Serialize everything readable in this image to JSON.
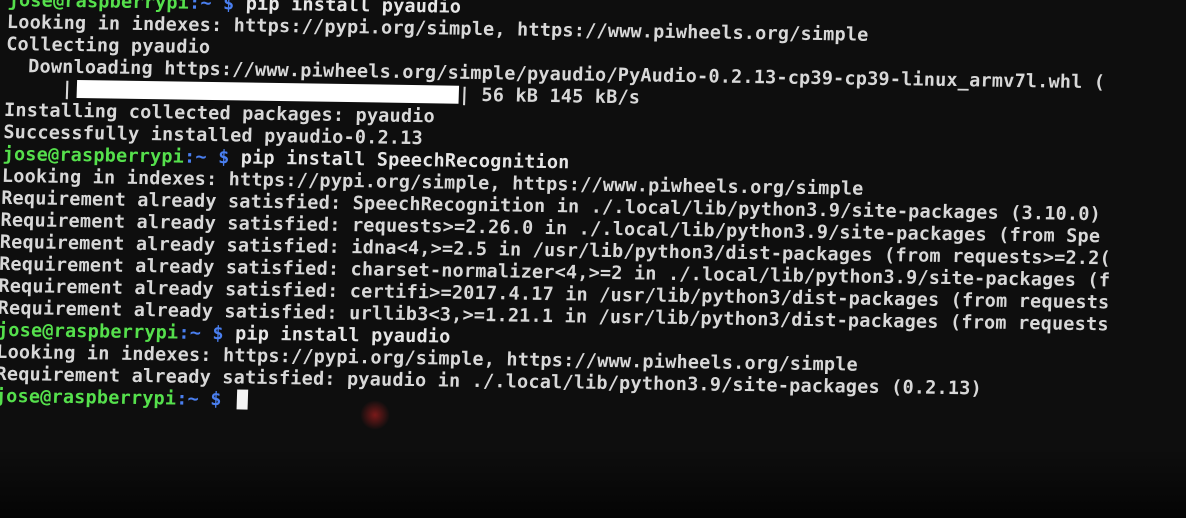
{
  "terminal": {
    "prompt": {
      "user_host": "jose@raspberrypi",
      "path": ":~",
      "symbol": "$"
    },
    "lines": [
      {
        "kind": "prompt",
        "command": "pip install pyaudio"
      },
      {
        "kind": "text",
        "text": "Looking in indexes: https://pypi.org/simple, https://www.piwheels.org/simple"
      },
      {
        "kind": "text",
        "text": "Collecting pyaudio"
      },
      {
        "kind": "text",
        "text": "  Downloading https://www.piwheels.org/simple/pyaudio/PyAudio-0.2.13-cp39-cp39-linux_armv7l.whl ("
      },
      {
        "kind": "progress",
        "prefix": "     |",
        "suffix": "| 56 kB 145 kB/s",
        "fill": 1.0
      },
      {
        "kind": "text",
        "text": "Installing collected packages: pyaudio"
      },
      {
        "kind": "text",
        "text": "Successfully installed pyaudio-0.2.13"
      },
      {
        "kind": "prompt",
        "command": "pip install SpeechRecognition"
      },
      {
        "kind": "text",
        "text": "Looking in indexes: https://pypi.org/simple, https://www.piwheels.org/simple"
      },
      {
        "kind": "text",
        "text": "Requirement already satisfied: SpeechRecognition in ./.local/lib/python3.9/site-packages (3.10.0)"
      },
      {
        "kind": "text",
        "text": "Requirement already satisfied: requests>=2.26.0 in ./.local/lib/python3.9/site-packages (from Spe"
      },
      {
        "kind": "text",
        "text": "Requirement already satisfied: idna<4,>=2.5 in /usr/lib/python3/dist-packages (from requests>=2.2("
      },
      {
        "kind": "text",
        "text": "Requirement already satisfied: charset-normalizer<4,>=2 in ./.local/lib/python3.9/site-packages (f"
      },
      {
        "kind": "text",
        "text": "Requirement already satisfied: certifi>=2017.4.17 in /usr/lib/python3/dist-packages (from requests"
      },
      {
        "kind": "text",
        "text": "Requirement already satisfied: urllib3<3,>=1.21.1 in /usr/lib/python3/dist-packages (from requests"
      },
      {
        "kind": "prompt",
        "command": "pip install pyaudio"
      },
      {
        "kind": "text",
        "text": "Looking in indexes: https://pypi.org/simple, https://www.piwheels.org/simple"
      },
      {
        "kind": "text",
        "text": "Requirement already satisfied: pyaudio in ./.local/lib/python3.9/site-packages (0.2.13)"
      },
      {
        "kind": "prompt_cursor",
        "command": ""
      }
    ]
  }
}
